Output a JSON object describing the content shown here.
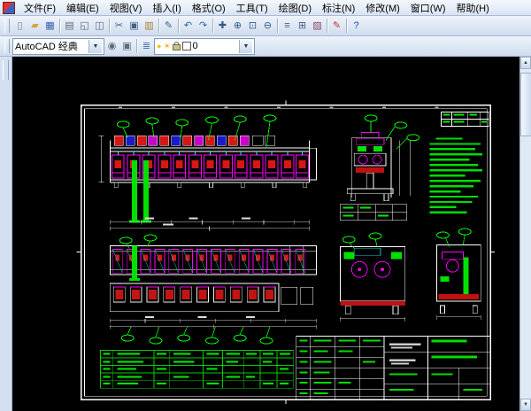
{
  "app": {
    "name": "AutoCAD"
  },
  "menubar": {
    "items": [
      {
        "label": "文件(F)"
      },
      {
        "label": "编辑(E)"
      },
      {
        "label": "视图(V)"
      },
      {
        "label": "插入(I)"
      },
      {
        "label": "格式(O)"
      },
      {
        "label": "工具(T)"
      },
      {
        "label": "绘图(D)"
      },
      {
        "label": "标注(N)"
      },
      {
        "label": "修改(M)"
      },
      {
        "label": "窗口(W)"
      },
      {
        "label": "帮助(H)"
      }
    ]
  },
  "standard_toolbar": {
    "buttons": [
      {
        "name": "new-file-icon",
        "glyph": "▯",
        "color": "#667f9f"
      },
      {
        "name": "open-folder-icon",
        "glyph": "▰",
        "color": "#d9a43b"
      },
      {
        "name": "save-icon",
        "glyph": "▦",
        "color": "#3a5fae"
      },
      {
        "name": "plot-icon",
        "glyph": "▤",
        "color": "#5a6b7c"
      },
      {
        "name": "plot-preview-icon",
        "glyph": "◱",
        "color": "#5a6b7c"
      },
      {
        "name": "publish-icon",
        "glyph": "◫",
        "color": "#5a6b7c"
      },
      {
        "name": "cut-icon",
        "glyph": "✂",
        "color": "#44618a"
      },
      {
        "name": "copy-icon",
        "glyph": "▣",
        "color": "#44618a"
      },
      {
        "name": "paste-icon",
        "glyph": "▥",
        "color": "#a8802f"
      },
      {
        "name": "match-properties-icon",
        "glyph": "✎",
        "color": "#44618a"
      },
      {
        "name": "undo-icon",
        "glyph": "↶",
        "color": "#2d5fa6"
      },
      {
        "name": "redo-icon",
        "glyph": "↷",
        "color": "#2d5fa6"
      },
      {
        "name": "pan-icon",
        "glyph": "✚",
        "color": "#30588c"
      },
      {
        "name": "zoom-realtime-icon",
        "glyph": "⊕",
        "color": "#30588c"
      },
      {
        "name": "zoom-window-icon",
        "glyph": "⊡",
        "color": "#30588c"
      },
      {
        "name": "zoom-previous-icon",
        "glyph": "⊖",
        "color": "#30588c"
      },
      {
        "name": "properties-icon",
        "glyph": "≡",
        "color": "#44618a"
      },
      {
        "name": "designcenter-icon",
        "glyph": "⊞",
        "color": "#44618a"
      },
      {
        "name": "tool-palettes-icon",
        "glyph": "▨",
        "color": "#8a4461"
      },
      {
        "name": "red-pencil-icon",
        "glyph": "✎",
        "color": "#c43030"
      },
      {
        "name": "help-icon",
        "glyph": "?",
        "color": "#1a49c0"
      }
    ]
  },
  "styles_toolbar": {
    "workspace_combo": {
      "value": "AutoCAD 经典"
    },
    "buttons": [
      {
        "name": "workspace-settings-icon",
        "glyph": "◉",
        "color": "#5a6b7c"
      },
      {
        "name": "save-workspace-icon",
        "glyph": "▣",
        "color": "#5a6b7c"
      },
      {
        "name": "layer-properties-icon",
        "glyph": "≣",
        "color": "#3f6fae"
      }
    ],
    "layer_combo": {
      "layer_name": "0",
      "layer_color": "#ffffff",
      "bulb_glyph": "●",
      "bulb_color": "#f2c41d",
      "sun_glyph": "☀",
      "sun_color": "#e8a81c"
    }
  },
  "ui": {
    "icons": {
      "dropdown_arrow": "▼",
      "scroll_up": "▲",
      "scroll_down": "▼"
    }
  },
  "colors": {
    "chrome": "#cfdcee",
    "canvas_bg": "#000000",
    "cad_white": "#ffffff",
    "cad_green": "#00ff00",
    "cad_red": "#d81616",
    "cad_magenta": "#ff00ff",
    "cad_cyan": "#00ffff",
    "cad_blue": "#1a1acc"
  }
}
